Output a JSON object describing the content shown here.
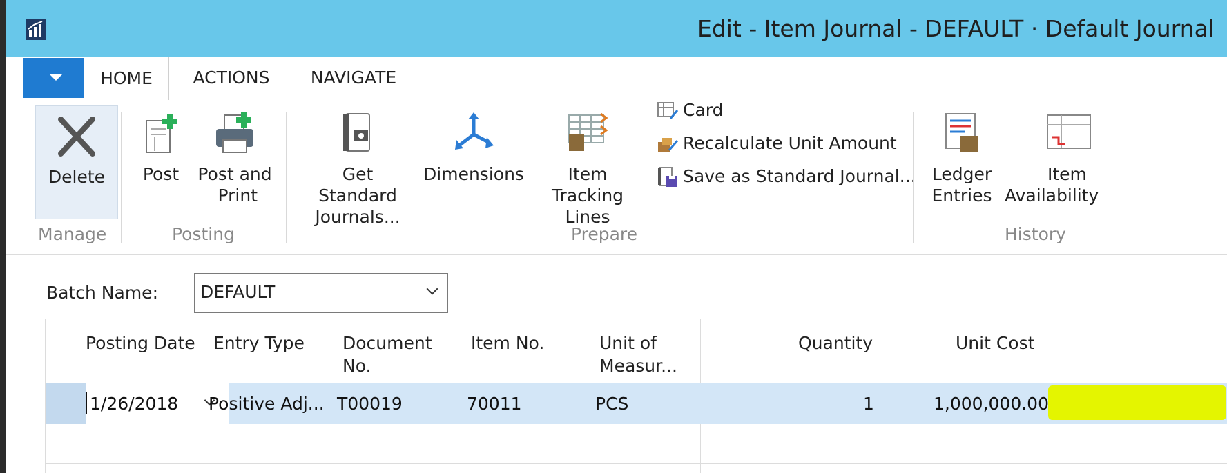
{
  "window": {
    "title": "Edit - Item Journal - DEFAULT · Default Journal"
  },
  "tabs": [
    {
      "label": "HOME",
      "active": true
    },
    {
      "label": "ACTIONS",
      "active": false
    },
    {
      "label": "NAVIGATE",
      "active": false
    }
  ],
  "ribbon": {
    "manage": {
      "group_label": "Manage",
      "delete_label": "Delete"
    },
    "posting": {
      "group_label": "Posting",
      "post_label": "Post",
      "post_and_print_label_line1": "Post and",
      "post_and_print_label_line2": "Print"
    },
    "prepare": {
      "group_label": "Prepare",
      "get_standard_journals_line1": "Get Standard",
      "get_standard_journals_line2": "Journals...",
      "dimensions_label": "Dimensions",
      "item_tracking_lines_line1": "Item",
      "item_tracking_lines_line2": "Tracking Lines",
      "card_label": "Card",
      "recalculate_label": "Recalculate Unit Amount",
      "save_standard_label": "Save as Standard Journal..."
    },
    "history": {
      "group_label": "History",
      "ledger_entries_line1": "Ledger",
      "ledger_entries_line2": "Entries",
      "item_availability_line1": "Item",
      "item_availability_line2": "Availability"
    }
  },
  "batch": {
    "label": "Batch Name:",
    "value": "DEFAULT"
  },
  "grid": {
    "headers": {
      "posting_date": "Posting Date",
      "entry_type": "Entry Type",
      "document_no_line1": "Document",
      "document_no_line2": "No.",
      "item_no": "Item No.",
      "unit_of_measure_line1": "Unit of",
      "unit_of_measure_line2": "Measur...",
      "quantity": "Quantity",
      "unit_cost": "Unit Cost"
    },
    "rows": [
      {
        "posting_date": "1/26/2018",
        "entry_type": "Positive Adj...",
        "document_no": "T00019",
        "item_no": "70011",
        "unit_of_measure": "PCS",
        "quantity": "1",
        "unit_cost": "1,000,000.00"
      }
    ]
  },
  "colors": {
    "titlebar": "#68c7ea",
    "app_menu": "#1f7bd1",
    "selected_row": "#d3e6f7",
    "highlight": "#e4f500"
  }
}
